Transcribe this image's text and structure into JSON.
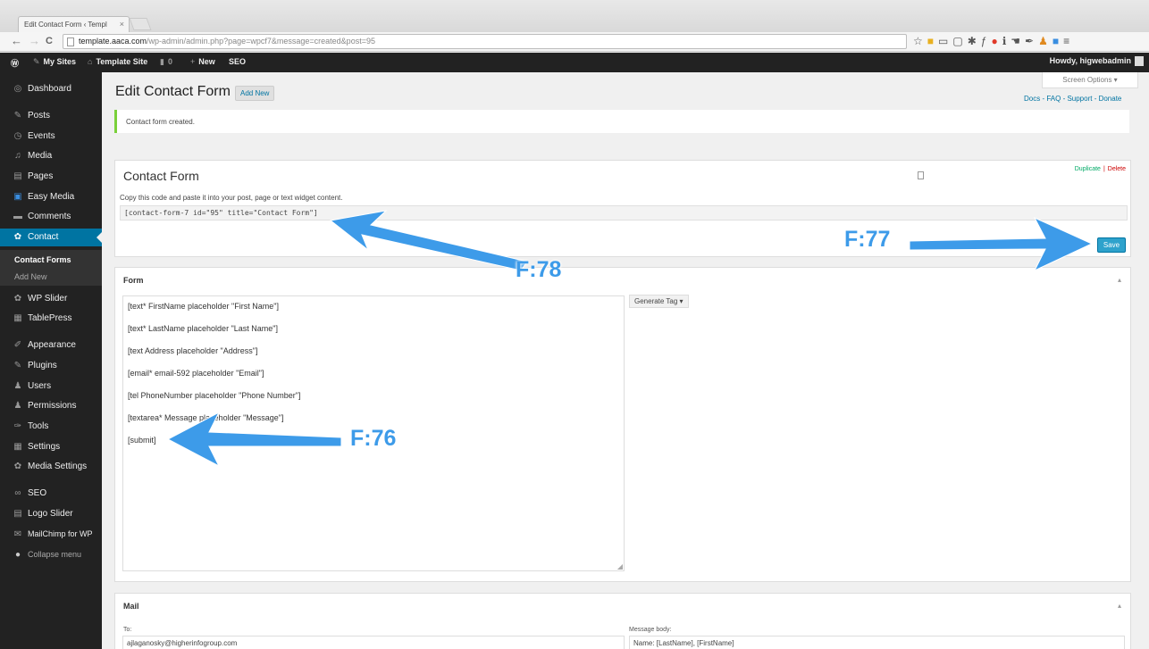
{
  "browser": {
    "tab_title": "Edit Contact Form ‹ Templ",
    "tab_close": "×",
    "url_host": "template.aaca.com",
    "url_path": "/wp-admin/admin.php?page=wpcf7&message=created&post=95",
    "back": "←",
    "forward": "→",
    "reload": "C",
    "extension_icons": [
      "star-icon",
      "puzzle-icon",
      "screen-icon",
      "square-icon",
      "gear-icon",
      "function-icon",
      "red-circle-icon",
      "info-icon",
      "hand-icon",
      "pen-icon",
      "person-icon",
      "box-icon",
      "menu-icon"
    ]
  },
  "adminbar": {
    "wp_logo": "Ⓦ",
    "my_sites": "My Sites",
    "site_name": "Template Site",
    "comments_count": "0",
    "new": "New",
    "seo": "SEO",
    "howdy": "Howdy, higwebadmin"
  },
  "sidebar": {
    "items": [
      {
        "label": "Dashboard",
        "icon": "dashboard-icon",
        "glyph": "◎"
      },
      {
        "label": "Posts",
        "icon": "pin-icon",
        "glyph": "✎"
      },
      {
        "label": "Events",
        "icon": "events-icon",
        "glyph": "◷"
      },
      {
        "label": "Media",
        "icon": "media-icon",
        "glyph": "♫"
      },
      {
        "label": "Pages",
        "icon": "pages-icon",
        "glyph": "▤"
      },
      {
        "label": "Easy Media",
        "icon": "easy-media-icon",
        "glyph": "▣"
      },
      {
        "label": "Comments",
        "icon": "comments-icon",
        "glyph": "▬"
      },
      {
        "label": "Contact",
        "icon": "contact-icon",
        "glyph": "✿"
      },
      {
        "label": "WP Slider",
        "icon": "slider-icon",
        "glyph": "✿"
      },
      {
        "label": "TablePress",
        "icon": "table-icon",
        "glyph": "▦"
      },
      {
        "label": "Appearance",
        "icon": "appearance-icon",
        "glyph": "✐"
      },
      {
        "label": "Plugins",
        "icon": "plugins-icon",
        "glyph": "✎"
      },
      {
        "label": "Users",
        "icon": "users-icon",
        "glyph": "♟"
      },
      {
        "label": "Permissions",
        "icon": "permissions-icon",
        "glyph": "♟"
      },
      {
        "label": "Tools",
        "icon": "tools-icon",
        "glyph": "✑"
      },
      {
        "label": "Settings",
        "icon": "settings-icon",
        "glyph": "▦"
      },
      {
        "label": "Media Settings",
        "icon": "media-settings-icon",
        "glyph": "✿"
      },
      {
        "label": "SEO",
        "icon": "seo-icon",
        "glyph": "∞"
      },
      {
        "label": "Logo Slider",
        "icon": "logo-slider-icon",
        "glyph": "▤"
      },
      {
        "label": "MailChimp for WP",
        "icon": "mailchimp-icon",
        "glyph": "✉"
      }
    ],
    "submenu": [
      "Contact Forms",
      "Add New"
    ],
    "collapse": "Collapse menu"
  },
  "header": {
    "title": "Edit Contact Form",
    "add_new": "Add New",
    "screen_options": "Screen Options ▾",
    "help_links": "Docs - FAQ - Support - Donate"
  },
  "notice": "Contact form created.",
  "contact_form": {
    "title": "Contact Form",
    "duplicate": "Duplicate",
    "separator": "|",
    "delete": "Delete",
    "help_text": "Copy this code and paste it into your post, page or text widget content.",
    "shortcode": "[contact-form-7 id=\"95\" title=\"Contact Form\"]",
    "save": "Save"
  },
  "form_box": {
    "title": "Form",
    "toggle": "▴",
    "lines": [
      "[text* FirstName placeholder \"First Name\"]",
      "[text* LastName placeholder \"Last Name\"]",
      "[text Address placeholder \"Address\"]",
      "[email* email-592 placeholder \"Email\"]",
      "[tel PhoneNumber placeholder \"Phone Number\"]",
      "[textarea* Message placeholder \"Message\"]",
      "[submit]"
    ],
    "generate_tag": "Generate Tag ▾"
  },
  "mail_box": {
    "title": "Mail",
    "toggle": "▴",
    "to_label": "To:",
    "to_value": "ajlaganosky@higherinfogroup.com",
    "body_label": "Message body:",
    "body_value": "Name: [LastName], [FirstName]"
  },
  "annotations": {
    "f76": "F:76",
    "f77": "F:77",
    "f78": "F:78"
  },
  "colors": {
    "admin_dark": "#222222",
    "active_menu": "#0074a2",
    "save_button": "#2ea2cc",
    "notice_border": "#7ad03a",
    "annotation": "#3d9be9"
  }
}
